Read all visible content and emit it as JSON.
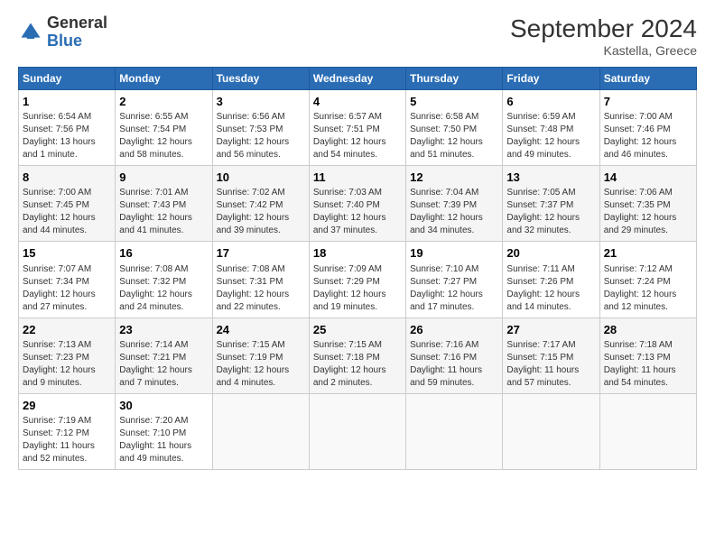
{
  "header": {
    "logo_general": "General",
    "logo_blue": "Blue",
    "title": "September 2024",
    "subtitle": "Kastella, Greece"
  },
  "calendar": {
    "weekdays": [
      "Sunday",
      "Monday",
      "Tuesday",
      "Wednesday",
      "Thursday",
      "Friday",
      "Saturday"
    ],
    "weeks": [
      [
        {
          "day": "1",
          "info": "Sunrise: 6:54 AM\nSunset: 7:56 PM\nDaylight: 13 hours\nand 1 minute."
        },
        {
          "day": "2",
          "info": "Sunrise: 6:55 AM\nSunset: 7:54 PM\nDaylight: 12 hours\nand 58 minutes."
        },
        {
          "day": "3",
          "info": "Sunrise: 6:56 AM\nSunset: 7:53 PM\nDaylight: 12 hours\nand 56 minutes."
        },
        {
          "day": "4",
          "info": "Sunrise: 6:57 AM\nSunset: 7:51 PM\nDaylight: 12 hours\nand 54 minutes."
        },
        {
          "day": "5",
          "info": "Sunrise: 6:58 AM\nSunset: 7:50 PM\nDaylight: 12 hours\nand 51 minutes."
        },
        {
          "day": "6",
          "info": "Sunrise: 6:59 AM\nSunset: 7:48 PM\nDaylight: 12 hours\nand 49 minutes."
        },
        {
          "day": "7",
          "info": "Sunrise: 7:00 AM\nSunset: 7:46 PM\nDaylight: 12 hours\nand 46 minutes."
        }
      ],
      [
        {
          "day": "8",
          "info": "Sunrise: 7:00 AM\nSunset: 7:45 PM\nDaylight: 12 hours\nand 44 minutes."
        },
        {
          "day": "9",
          "info": "Sunrise: 7:01 AM\nSunset: 7:43 PM\nDaylight: 12 hours\nand 41 minutes."
        },
        {
          "day": "10",
          "info": "Sunrise: 7:02 AM\nSunset: 7:42 PM\nDaylight: 12 hours\nand 39 minutes."
        },
        {
          "day": "11",
          "info": "Sunrise: 7:03 AM\nSunset: 7:40 PM\nDaylight: 12 hours\nand 37 minutes."
        },
        {
          "day": "12",
          "info": "Sunrise: 7:04 AM\nSunset: 7:39 PM\nDaylight: 12 hours\nand 34 minutes."
        },
        {
          "day": "13",
          "info": "Sunrise: 7:05 AM\nSunset: 7:37 PM\nDaylight: 12 hours\nand 32 minutes."
        },
        {
          "day": "14",
          "info": "Sunrise: 7:06 AM\nSunset: 7:35 PM\nDaylight: 12 hours\nand 29 minutes."
        }
      ],
      [
        {
          "day": "15",
          "info": "Sunrise: 7:07 AM\nSunset: 7:34 PM\nDaylight: 12 hours\nand 27 minutes."
        },
        {
          "day": "16",
          "info": "Sunrise: 7:08 AM\nSunset: 7:32 PM\nDaylight: 12 hours\nand 24 minutes."
        },
        {
          "day": "17",
          "info": "Sunrise: 7:08 AM\nSunset: 7:31 PM\nDaylight: 12 hours\nand 22 minutes."
        },
        {
          "day": "18",
          "info": "Sunrise: 7:09 AM\nSunset: 7:29 PM\nDaylight: 12 hours\nand 19 minutes."
        },
        {
          "day": "19",
          "info": "Sunrise: 7:10 AM\nSunset: 7:27 PM\nDaylight: 12 hours\nand 17 minutes."
        },
        {
          "day": "20",
          "info": "Sunrise: 7:11 AM\nSunset: 7:26 PM\nDaylight: 12 hours\nand 14 minutes."
        },
        {
          "day": "21",
          "info": "Sunrise: 7:12 AM\nSunset: 7:24 PM\nDaylight: 12 hours\nand 12 minutes."
        }
      ],
      [
        {
          "day": "22",
          "info": "Sunrise: 7:13 AM\nSunset: 7:23 PM\nDaylight: 12 hours\nand 9 minutes."
        },
        {
          "day": "23",
          "info": "Sunrise: 7:14 AM\nSunset: 7:21 PM\nDaylight: 12 hours\nand 7 minutes."
        },
        {
          "day": "24",
          "info": "Sunrise: 7:15 AM\nSunset: 7:19 PM\nDaylight: 12 hours\nand 4 minutes."
        },
        {
          "day": "25",
          "info": "Sunrise: 7:15 AM\nSunset: 7:18 PM\nDaylight: 12 hours\nand 2 minutes."
        },
        {
          "day": "26",
          "info": "Sunrise: 7:16 AM\nSunset: 7:16 PM\nDaylight: 11 hours\nand 59 minutes."
        },
        {
          "day": "27",
          "info": "Sunrise: 7:17 AM\nSunset: 7:15 PM\nDaylight: 11 hours\nand 57 minutes."
        },
        {
          "day": "28",
          "info": "Sunrise: 7:18 AM\nSunset: 7:13 PM\nDaylight: 11 hours\nand 54 minutes."
        }
      ],
      [
        {
          "day": "29",
          "info": "Sunrise: 7:19 AM\nSunset: 7:12 PM\nDaylight: 11 hours\nand 52 minutes."
        },
        {
          "day": "30",
          "info": "Sunrise: 7:20 AM\nSunset: 7:10 PM\nDaylight: 11 hours\nand 49 minutes."
        },
        {
          "day": "",
          "info": ""
        },
        {
          "day": "",
          "info": ""
        },
        {
          "day": "",
          "info": ""
        },
        {
          "day": "",
          "info": ""
        },
        {
          "day": "",
          "info": ""
        }
      ]
    ]
  }
}
